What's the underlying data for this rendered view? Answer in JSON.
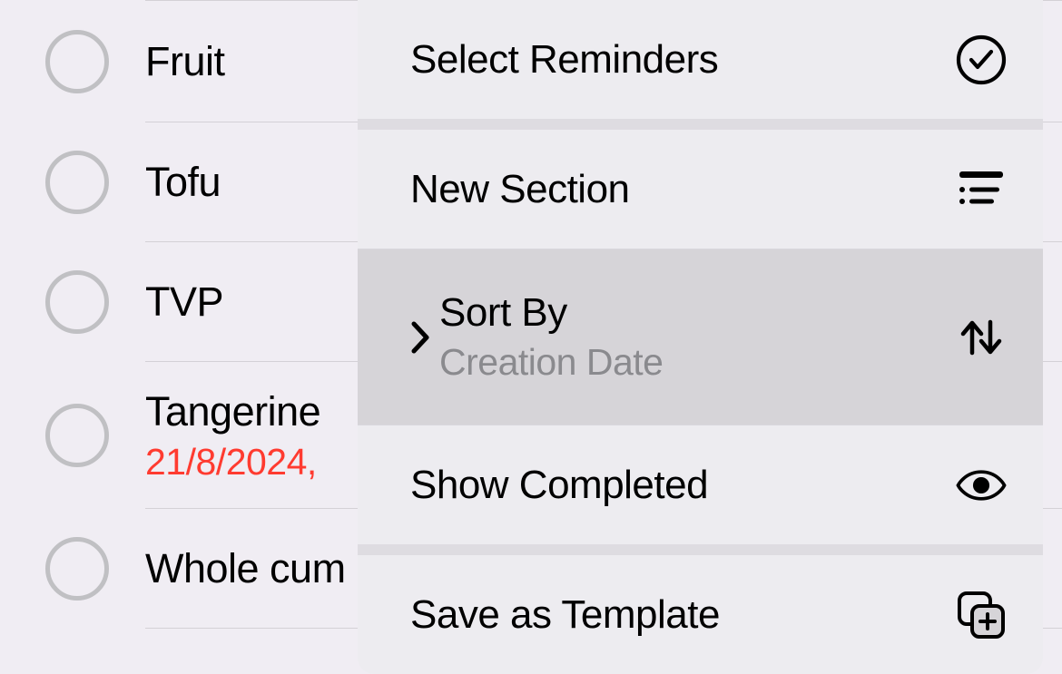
{
  "reminders": [
    {
      "label": "Fruit",
      "date": null
    },
    {
      "label": "Tofu",
      "date": null
    },
    {
      "label": "TVP",
      "date": null
    },
    {
      "label": "Tangerine",
      "date": "21/8/2024,"
    },
    {
      "label": "Whole cum",
      "date": null
    }
  ],
  "menu": {
    "select_reminders": "Select Reminders",
    "new_section": "New Section",
    "sort_by": {
      "label": "Sort By",
      "value": "Creation Date"
    },
    "show_completed": "Show Completed",
    "save_as_template": "Save as Template"
  }
}
